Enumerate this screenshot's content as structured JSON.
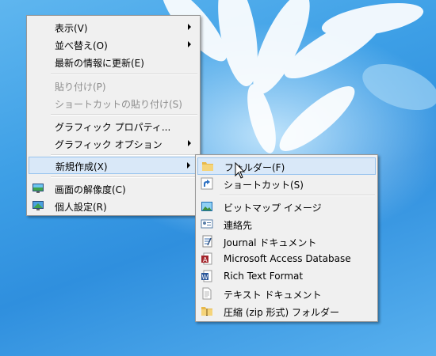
{
  "context_menu": {
    "items": [
      {
        "label": "表示(V)"
      },
      {
        "label": "並べ替え(O)"
      },
      {
        "label": "最新の情報に更新(E)"
      },
      {
        "label": "貼り付け(P)"
      },
      {
        "label": "ショートカットの貼り付け(S)"
      },
      {
        "label": "グラフィック プロパティ..."
      },
      {
        "label": "グラフィック オプション"
      },
      {
        "label": "新規作成(X)"
      },
      {
        "label": "画面の解像度(C)"
      },
      {
        "label": "個人設定(R)"
      }
    ]
  },
  "new_submenu": {
    "items": [
      {
        "label": "フォルダー(F)",
        "icon": "folder-icon"
      },
      {
        "label": "ショートカット(S)",
        "icon": "shortcut-icon"
      },
      {
        "label": "ビットマップ イメージ",
        "icon": "bitmap-image-icon"
      },
      {
        "label": "連絡先",
        "icon": "contact-icon"
      },
      {
        "label": "Journal ドキュメント",
        "icon": "journal-document-icon"
      },
      {
        "label": "Microsoft Access Database",
        "icon": "access-database-icon"
      },
      {
        "label": "Rich Text Format",
        "icon": "rich-text-icon"
      },
      {
        "label": "テキスト ドキュメント",
        "icon": "text-document-icon"
      },
      {
        "label": "圧縮 (zip 形式) フォルダー",
        "icon": "zip-folder-icon"
      }
    ]
  },
  "colors": {
    "menu_bg": "#f0f0f0",
    "highlight": "#d9e8f8",
    "highlight_border": "#99c4ee",
    "desktop": "#3d9fe6"
  }
}
